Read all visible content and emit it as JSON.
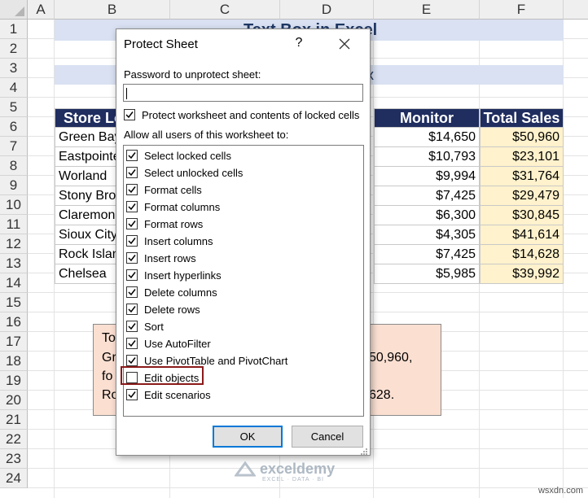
{
  "columns": [
    "A",
    "B",
    "C",
    "D",
    "E",
    "F"
  ],
  "rows": [
    "1",
    "2",
    "3",
    "4",
    "5",
    "6",
    "7",
    "8",
    "9",
    "10",
    "11",
    "12",
    "13",
    "14",
    "15",
    "16",
    "17",
    "18",
    "19",
    "20",
    "21",
    "22",
    "23",
    "24"
  ],
  "title_fragment": "Text Box in Excel",
  "subtitle_fragment": "x",
  "table": {
    "headers": {
      "store": "Store Lo",
      "monitor": "Monitor",
      "total": "Total Sales"
    },
    "rows": [
      {
        "store": "Green Bay",
        "monitor": "$14,650",
        "total": "$50,960"
      },
      {
        "store": "Eastpointe",
        "monitor": "$10,793",
        "total": "$23,101"
      },
      {
        "store": "Worland",
        "monitor": "$9,994",
        "total": "$31,764"
      },
      {
        "store": "Stony Bro",
        "monitor": "$7,425",
        "total": "$29,479"
      },
      {
        "store": "Claremon",
        "monitor": "$6,300",
        "total": "$30,845"
      },
      {
        "store": "Sioux City",
        "monitor": "$4,305",
        "total": "$41,614"
      },
      {
        "store": "Rock Islan",
        "monitor": "$7,425",
        "total": "$14,628"
      },
      {
        "store": "Chelsea",
        "monitor": "$5,985",
        "total": "$39,992"
      }
    ]
  },
  "textbox": {
    "left_lines": [
      "To",
      "Gr",
      "fo",
      "Ro"
    ],
    "right_lines": [
      "50,960,",
      "628."
    ]
  },
  "dialog": {
    "title": "Protect Sheet",
    "help": "?",
    "password_label": "Password to unprotect sheet:",
    "password_value": "",
    "protect_label": "Protect worksheet and contents of locked cells",
    "protect_checked": true,
    "allow_label": "Allow all users of this worksheet to:",
    "permissions": [
      {
        "label": "Select locked cells",
        "checked": true
      },
      {
        "label": "Select unlocked cells",
        "checked": true
      },
      {
        "label": "Format cells",
        "checked": true
      },
      {
        "label": "Format columns",
        "checked": true
      },
      {
        "label": "Format rows",
        "checked": true
      },
      {
        "label": "Insert columns",
        "checked": true
      },
      {
        "label": "Insert rows",
        "checked": true
      },
      {
        "label": "Insert hyperlinks",
        "checked": true
      },
      {
        "label": "Delete columns",
        "checked": true
      },
      {
        "label": "Delete rows",
        "checked": true
      },
      {
        "label": "Sort",
        "checked": true
      },
      {
        "label": "Use AutoFilter",
        "checked": true
      },
      {
        "label": "Use PivotTable and PivotChart",
        "checked": true
      },
      {
        "label": "Edit objects",
        "checked": false
      },
      {
        "label": "Edit scenarios",
        "checked": true
      }
    ],
    "ok_label": "OK",
    "cancel_label": "Cancel"
  },
  "watermark": {
    "name": "exceldemy",
    "tagline": "EXCEL · DATA · BI",
    "site": "wsxdn.com"
  },
  "colors": {
    "header_navy": "#1f2d5f",
    "title_band": "#d9e1f2",
    "sales_fill": "#fff2cc",
    "note_fill": "#fbe0d2",
    "highlight": "#8b1a1a",
    "ok_border": "#0078d7"
  }
}
